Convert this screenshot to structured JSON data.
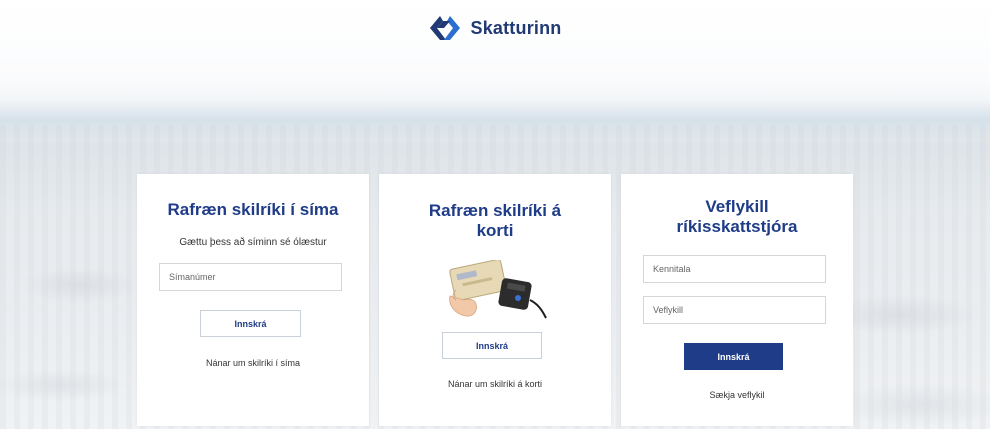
{
  "header": {
    "brand": "Skatturinn",
    "logo_icon": "skatturinn-logo-icon",
    "brand_color": "#213a73"
  },
  "cards": [
    {
      "title": "Rafræn skilríki í síma",
      "subtitle": "Gættu þess að síminn sé ólæstur",
      "phone_placeholder": "Símanúmer",
      "button_label": "Innskrá",
      "link_label": "Nánar um skilríki í síma"
    },
    {
      "title_line1": "Rafræn skilríki á",
      "title_line2": "korti",
      "image_icon": "card-reader-icon",
      "button_label": "Innskrá",
      "link_label": "Nánar um skilríki á korti"
    },
    {
      "title_line1": "Veflykill",
      "title_line2": "ríkisskattstjóra",
      "id_placeholder": "Kennitala",
      "key_placeholder": "Veflykill",
      "button_label": "Innskrá",
      "link_label": "Sækja veflykil"
    }
  ],
  "colors": {
    "accent": "#1f3c88",
    "card_bg": "#ffffff"
  }
}
